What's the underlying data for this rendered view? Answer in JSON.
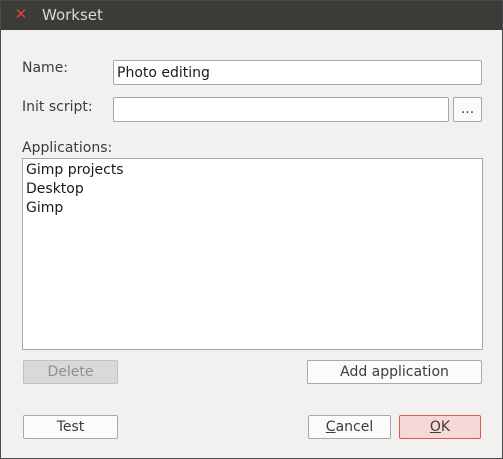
{
  "window": {
    "title": "Workset",
    "close_symbol": "✕"
  },
  "form": {
    "name_label": "Name:",
    "name_value": "Photo editing",
    "init_script_label": "Init script:",
    "init_script_value": "",
    "browse_label": "...",
    "applications_label": "Applications:"
  },
  "applications": [
    "Gimp projects",
    "Desktop",
    "Gimp"
  ],
  "buttons": {
    "delete": "Delete",
    "add_application": "Add application",
    "test": "Test",
    "cancel_mnemonic": "C",
    "cancel_rest": "ancel",
    "ok_mnemonic": "O",
    "ok_rest": "K"
  },
  "colors": {
    "titlebar": "#3c3b37",
    "close": "#e0453b",
    "default_button": "#f6d9d7",
    "accent_border": "#d85a52"
  }
}
